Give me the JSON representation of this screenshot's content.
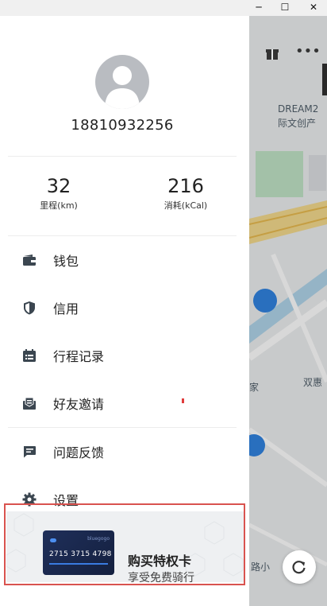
{
  "window": {
    "minimize_glyph": "─",
    "maximize_glyph": "☐",
    "close_glyph": "✕"
  },
  "profile": {
    "phone": "18810932256"
  },
  "stats": [
    {
      "value": "32",
      "label": "里程(km)"
    },
    {
      "value": "216",
      "label": "消耗(kCal)"
    }
  ],
  "menu": [
    {
      "label": "钱包",
      "icon": "wallet-icon"
    },
    {
      "label": "信用",
      "icon": "shield-icon"
    },
    {
      "label": "行程记录",
      "icon": "calendar-list-icon"
    },
    {
      "label": "好友邀请",
      "icon": "invite-envelope-icon"
    },
    {
      "label": "问题反馈",
      "icon": "chat-feedback-icon"
    },
    {
      "label": "设置",
      "icon": "gear-icon"
    }
  ],
  "promo": {
    "card_number": "2715 3715 4798",
    "card_brand": "bluegogo",
    "title": "购买特权卡",
    "subtitle": "享受免费骑行"
  },
  "map": {
    "label_dream": "DREAM2",
    "label_chuangchan": "际文创产",
    "label_shuanghui": "双惠",
    "label_jia": "家",
    "label_road": "路小"
  },
  "colors": {
    "accent_blue": "#2a7fe0",
    "highlight_red": "#d9534f",
    "icon_dark": "#3b4650"
  }
}
